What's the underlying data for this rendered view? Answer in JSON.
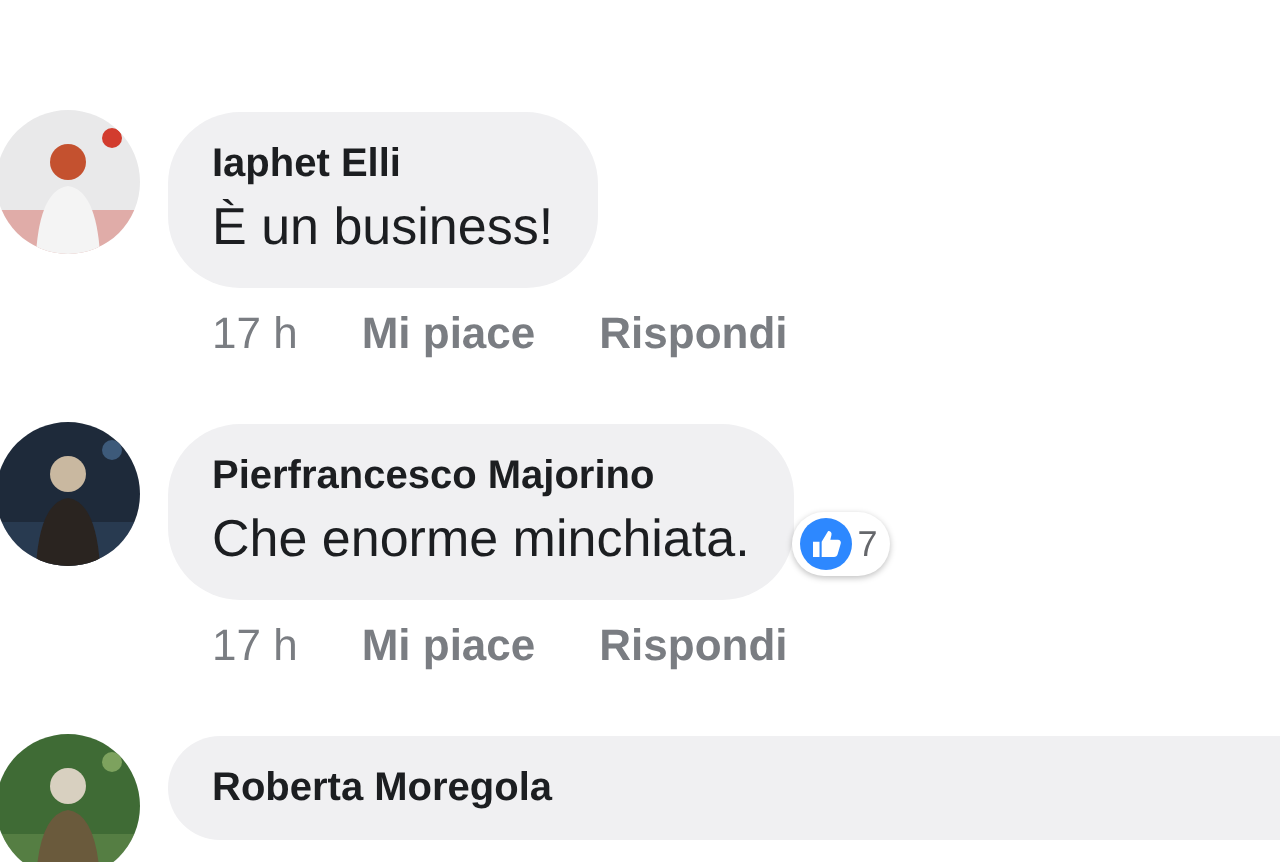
{
  "comments": [
    {
      "author": "Iaphet Elli",
      "text": "È un business!",
      "time": "17 h",
      "actions": [
        "Mi piace",
        "Rispondi"
      ],
      "avatar": {
        "kind": "picture"
      }
    },
    {
      "author": "Pierfrancesco Majorino",
      "text": "Che enorme minchiata.",
      "reaction": {
        "count": "7"
      },
      "time": "17 h",
      "actions": [
        "Mi piace",
        "Rispondi"
      ],
      "avatar": {
        "kind": "picture"
      }
    },
    {
      "author": "Roberta Moregola",
      "avatar": {
        "kind": "picture"
      }
    }
  ]
}
